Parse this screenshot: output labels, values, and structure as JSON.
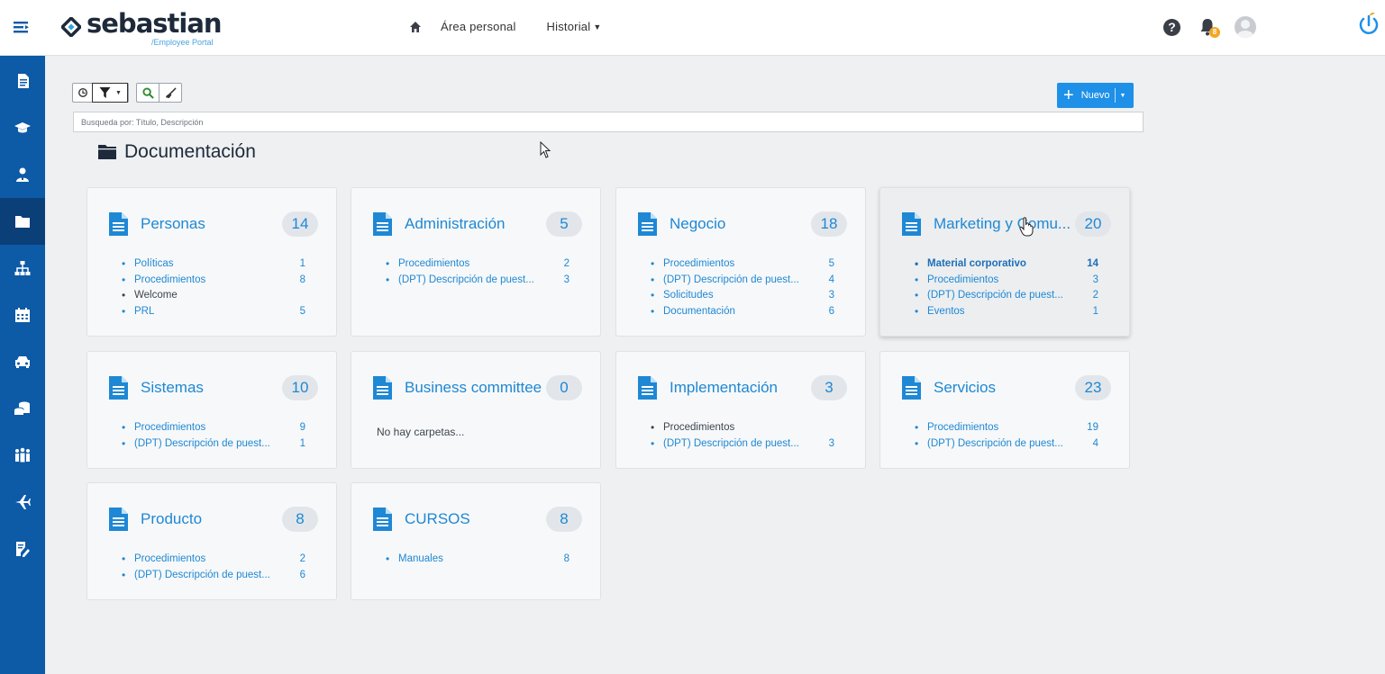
{
  "header": {
    "logo_text": "sebastian",
    "logo_sub": "/Employee Portal",
    "nav": [
      {
        "label": "Área personal"
      },
      {
        "label": "Historial"
      }
    ],
    "notifications_count": "8",
    "help_symbol": "?"
  },
  "toolbar": {
    "new_label": "Nuevo",
    "search_placeholder": "Busqueda por: Título, Descripción"
  },
  "section": {
    "title": "Documentación"
  },
  "cards": [
    {
      "title": "Personas",
      "count": "14",
      "items": [
        {
          "name": "Políticas",
          "count": "1"
        },
        {
          "name": "Procedimientos",
          "count": "8"
        },
        {
          "name": "Welcome",
          "count": ""
        },
        {
          "name": "PRL",
          "count": "5"
        }
      ]
    },
    {
      "title": "Administración",
      "count": "5",
      "items": [
        {
          "name": "Procedimientos",
          "count": "2"
        },
        {
          "name": "(DPT) Descripción de puest...",
          "count": "3"
        }
      ]
    },
    {
      "title": "Negocio",
      "count": "18",
      "items": [
        {
          "name": "Procedimientos",
          "count": "5"
        },
        {
          "name": "(DPT) Descripción de puest...",
          "count": "4"
        },
        {
          "name": "Solicitudes",
          "count": "3"
        },
        {
          "name": "Documentación",
          "count": "6"
        }
      ]
    },
    {
      "title": "Marketing y Comu...",
      "count": "20",
      "items": [
        {
          "name": "Material corporativo",
          "count": "14"
        },
        {
          "name": "Procedimientos",
          "count": "3"
        },
        {
          "name": "(DPT) Descripción de puest...",
          "count": "2"
        },
        {
          "name": "Eventos",
          "count": "1"
        }
      ]
    },
    {
      "title": "Sistemas",
      "count": "10",
      "items": [
        {
          "name": "Procedimientos",
          "count": "9"
        },
        {
          "name": "(DPT) Descripción de puest...",
          "count": "1"
        }
      ]
    },
    {
      "title": "Business committee",
      "count": "0",
      "empty": "No hay carpetas..."
    },
    {
      "title": "Implementación",
      "count": "3",
      "items": [
        {
          "name": "Procedimientos",
          "count": ""
        },
        {
          "name": "(DPT) Descripción de puest...",
          "count": "3"
        }
      ]
    },
    {
      "title": "Servicios",
      "count": "23",
      "items": [
        {
          "name": "Procedimientos",
          "count": "19"
        },
        {
          "name": "(DPT) Descripción de puest...",
          "count": "4"
        }
      ]
    },
    {
      "title": "Producto",
      "count": "8",
      "items": [
        {
          "name": "Procedimientos",
          "count": "2"
        },
        {
          "name": "(DPT) Descripción de puest...",
          "count": "6"
        }
      ]
    },
    {
      "title": "CURSOS",
      "count": "8",
      "items": [
        {
          "name": "Manuales",
          "count": "8"
        }
      ]
    }
  ],
  "sidebar": {
    "icons": [
      "document-icon",
      "graduation-cap-icon",
      "user-tie-icon",
      "folder-icon",
      "org-chart-icon",
      "calendar-icon",
      "car-icon",
      "coins-icon",
      "team-icon",
      "plane-icon",
      "form-edit-icon"
    ],
    "active_index": 3
  },
  "colors": {
    "sidebar": "#0d5aa7",
    "accent": "#1e90e8",
    "link": "#1e88d5",
    "badge": "#f2a623"
  }
}
